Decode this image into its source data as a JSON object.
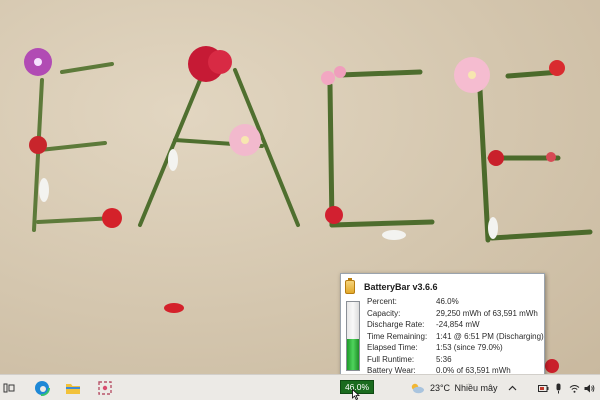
{
  "popup": {
    "title": "BatteryBar v3.6.6",
    "level_percent": 46,
    "rows": [
      {
        "label": "Percent:",
        "value": "46.0%"
      },
      {
        "label": "Capacity:",
        "value": "29,250 mWh of 63,591 mWh"
      },
      {
        "label": "Discharge Rate:",
        "value": "-24,854 mW"
      },
      {
        "label": "Time Remaining:",
        "value": "1:41 @ 6:51 PM (Discharging)"
      },
      {
        "label": "Elapsed Time:",
        "value": "1:53 (since 79.0%)"
      },
      {
        "label": "Full Runtime:",
        "value": "5:36"
      },
      {
        "label": "Battery Wear:",
        "value": "0.0% of 63,591 mWh"
      }
    ]
  },
  "taskbar": {
    "battery_badge": "46.0%",
    "weather": {
      "temp": "23°C",
      "desc": "Nhiều mây"
    },
    "icons": [
      "task-view-icon",
      "edge-browser-icon",
      "file-explorer-icon",
      "snipping-tool-icon",
      "cloud-sun-icon",
      "chevron-up-icon",
      "battery-icon",
      "microphone-icon",
      "wifi-icon",
      "speaker-icon"
    ]
  },
  "colors": {
    "badge_green": "#1a6b1e",
    "gauge_green": "#3cc24a",
    "taskbar_bg": "#eceae6",
    "sand": "#d6c9b2"
  }
}
